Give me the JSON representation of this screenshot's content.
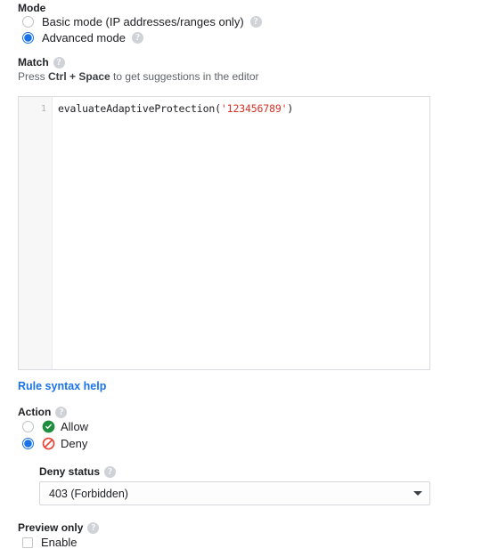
{
  "mode": {
    "label": "Mode",
    "options": [
      {
        "label": "Basic mode (IP addresses/ranges only)",
        "selected": false,
        "help": "?"
      },
      {
        "label": "Advanced mode",
        "selected": true,
        "help": "?"
      }
    ]
  },
  "match": {
    "label": "Match",
    "help": "?",
    "hint_prefix": "Press ",
    "hint_key": "Ctrl + Space",
    "hint_suffix": " to get suggestions in the editor",
    "editor": {
      "line_number": "1",
      "code_prefix": "evaluateAdaptiveProtection(",
      "code_string": "'123456789'",
      "code_suffix": ")"
    }
  },
  "rule_syntax_help_link": "Rule syntax help",
  "action": {
    "label": "Action",
    "help": "?",
    "options": [
      {
        "label": "Allow",
        "selected": false,
        "icon": "check-circle-icon",
        "color": "#1e8e3e"
      },
      {
        "label": "Deny",
        "selected": true,
        "icon": "block-icon",
        "color": "#ea4335"
      }
    ]
  },
  "deny_status": {
    "label": "Deny status",
    "help": "?",
    "value": "403 (Forbidden)",
    "caret": "chevron-down-icon"
  },
  "preview_only": {
    "label": "Preview only",
    "help": "?",
    "checkbox_label": "Enable",
    "checked": false
  },
  "colors": {
    "accent_blue": "#1a73e8",
    "allow_green": "#1e8e3e",
    "deny_red": "#ea4335",
    "string_red": "#d93025",
    "border_gray": "#dadce0",
    "muted_text": "#5f6368"
  }
}
